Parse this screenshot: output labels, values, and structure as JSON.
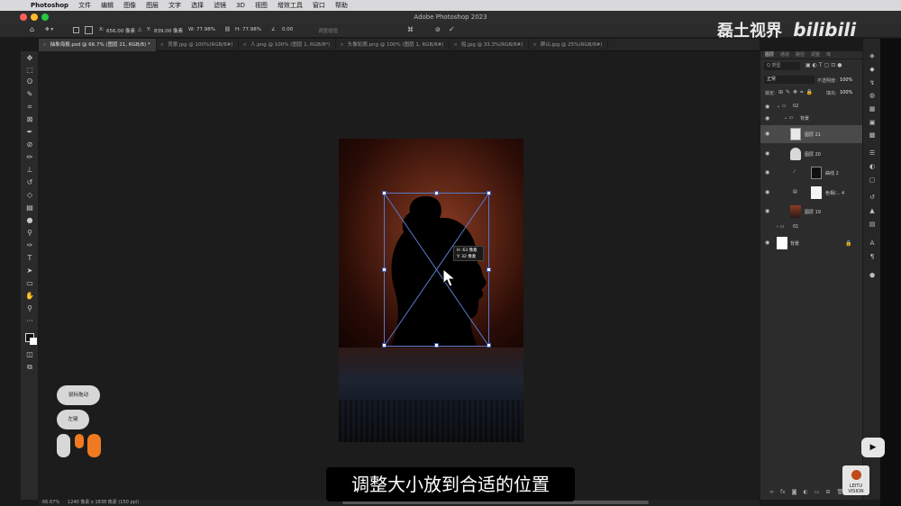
{
  "menubar": {
    "apple": "",
    "app_name": "Photoshop",
    "items": [
      "文件",
      "编辑",
      "图像",
      "图层",
      "文字",
      "选择",
      "滤镜",
      "3D",
      "视图",
      "增效工具",
      "窗口",
      "帮助"
    ]
  },
  "window": {
    "title": "Adobe Photoshop 2023"
  },
  "options": {
    "x_label": "X:",
    "x_value": "656.00 像素",
    "y_label": "Y:",
    "y_value": "839.00 像素",
    "w_label": "W:",
    "w_value": "77.98%",
    "h_label": "H:",
    "h_value": "77.98%",
    "angle_value": "0.00",
    "interp_label": "调整插值",
    "cancel_glyph": "⊘",
    "commit_glyph": "✓"
  },
  "tabs": [
    {
      "label": "抽象海报.psd @ 66.7% (图层 21, RGB/8) *",
      "active": true
    },
    {
      "label": "背景.jpg @ 100%(RGB/8#)",
      "active": false
    },
    {
      "label": "人.png @ 100% (图层 1, RGB/8*)",
      "active": false
    },
    {
      "label": "头像轮廓.png @ 100% (图层 1, RGB/8#)",
      "active": false
    },
    {
      "label": "船.jpg @ 33.3%(RGB/8#)",
      "active": false
    },
    {
      "label": "群山.jpg @ 25%(RGB/8#)",
      "active": false
    }
  ],
  "transform": {
    "readout_line1": "H: 63 像素",
    "readout_line2": "Y: 32 像素"
  },
  "layers_panel": {
    "tabs": [
      "图层",
      "通道",
      "路径",
      "调整",
      "库"
    ],
    "filter_placeholder": "Q 类型",
    "blend_mode": "正常",
    "opacity_label": "不透明度:",
    "opacity_value": "100%",
    "lock_label": "锁定:",
    "fill_label": "填充:",
    "fill_value": "100%",
    "layers": [
      {
        "name": "02",
        "kind": "group"
      },
      {
        "name": "背景",
        "kind": "group"
      },
      {
        "name": "图层 21",
        "kind": "layer",
        "selected": true
      },
      {
        "name": "图层 20",
        "kind": "layer"
      },
      {
        "name": "曲线 2",
        "kind": "adjustment"
      },
      {
        "name": "色相/... 4",
        "kind": "adjustment"
      },
      {
        "name": "图层 19",
        "kind": "layer"
      },
      {
        "name": "01",
        "kind": "group"
      },
      {
        "name": "背景",
        "kind": "background"
      }
    ],
    "footer_icons": [
      "link-icon",
      "fx-icon",
      "mask-icon",
      "adjustment-icon",
      "folder-icon",
      "new-layer-icon",
      "trash-icon"
    ]
  },
  "status": {
    "zoom": "66.67%",
    "doc_info": "1240 像素 x 1838 像素 (150 ppi)"
  },
  "overlay": {
    "pill1": "鼠标拖动",
    "pill2": "左键",
    "subtitle": "调整大小放到合适的位置",
    "watermark": "磊土视界",
    "watermark_brand": "bilibili",
    "logo_text": "LEITU VISION"
  },
  "colors": {
    "accent_blue": "#5a78c8",
    "mouse_orange": "#f07a21"
  }
}
